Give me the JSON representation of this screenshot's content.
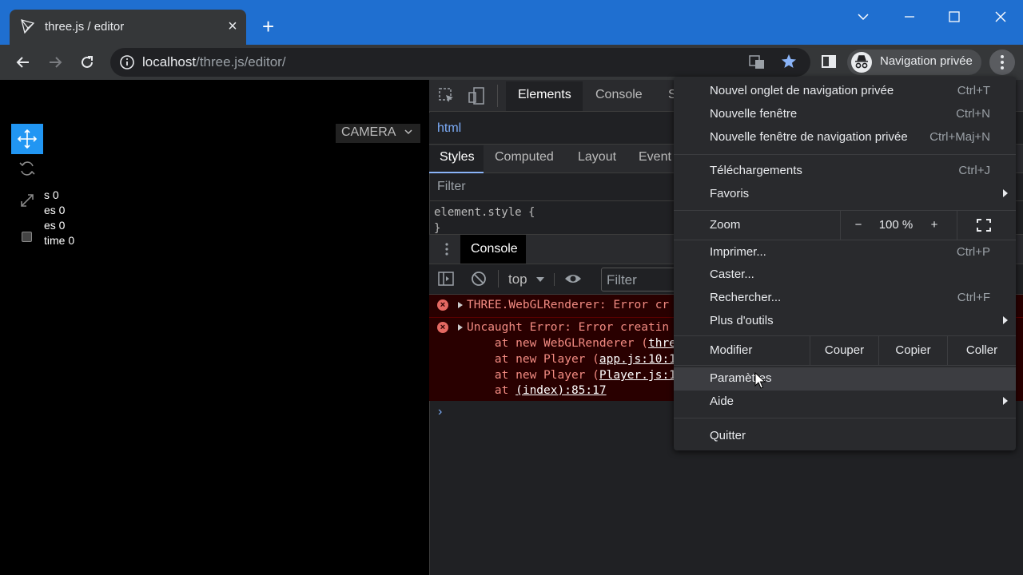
{
  "browser": {
    "tab_title": "three.js / editor",
    "tab_close": "×",
    "new_tab": "+",
    "url_host": "localhost",
    "url_path": "/three.js/editor/",
    "profile_label": "Navigation privée"
  },
  "editor": {
    "camera_select": "CAMERA",
    "info": [
      "s 0",
      "es 0",
      "es 0",
      "time 0"
    ]
  },
  "devtools": {
    "tabs": [
      "Elements",
      "Console",
      "S"
    ],
    "breadcrumb": "html",
    "style_tabs": [
      "Styles",
      "Computed",
      "Layout",
      "Event"
    ],
    "styles_filter": "Filter",
    "element_style": "element.style {\n}",
    "drawer_tab": "Console",
    "context": "top",
    "console_filter": "Filter",
    "errors": {
      "e1": "THREE.WebGLRenderer: Error cr",
      "e2": "Uncaught Error: Error creatin",
      "s1_pre": "    at new WebGLRenderer (",
      "s1_link": "three",
      "s2_pre": "    at new Player (",
      "s2_link": "app.js:10:1",
      "s3_pre": "    at new Player (",
      "s3_link": "Player.js:1",
      "s4_pre": "    at ",
      "s4_link": "(index):85:17"
    },
    "prompt": "›"
  },
  "menu": {
    "new_incognito_tab": {
      "label": "Nouvel onglet de navigation privée",
      "shortcut": "Ctrl+T"
    },
    "new_window": {
      "label": "Nouvelle fenêtre",
      "shortcut": "Ctrl+N"
    },
    "new_incognito_window": {
      "label": "Nouvelle fenêtre de navigation privée",
      "shortcut": "Ctrl+Maj+N"
    },
    "downloads": {
      "label": "Téléchargements",
      "shortcut": "Ctrl+J"
    },
    "bookmarks": {
      "label": "Favoris"
    },
    "zoom": {
      "label": "Zoom",
      "minus": "−",
      "value": "100 %",
      "plus": "+"
    },
    "print": {
      "label": "Imprimer...",
      "shortcut": "Ctrl+P"
    },
    "cast": {
      "label": "Caster..."
    },
    "find": {
      "label": "Rechercher...",
      "shortcut": "Ctrl+F"
    },
    "more_tools": {
      "label": "Plus d'outils"
    },
    "edit": {
      "label": "Modifier",
      "cut": "Couper",
      "copy": "Copier",
      "paste": "Coller"
    },
    "settings": {
      "label": "Paramètres"
    },
    "help": {
      "label": "Aide"
    },
    "quit": {
      "label": "Quitter"
    }
  }
}
